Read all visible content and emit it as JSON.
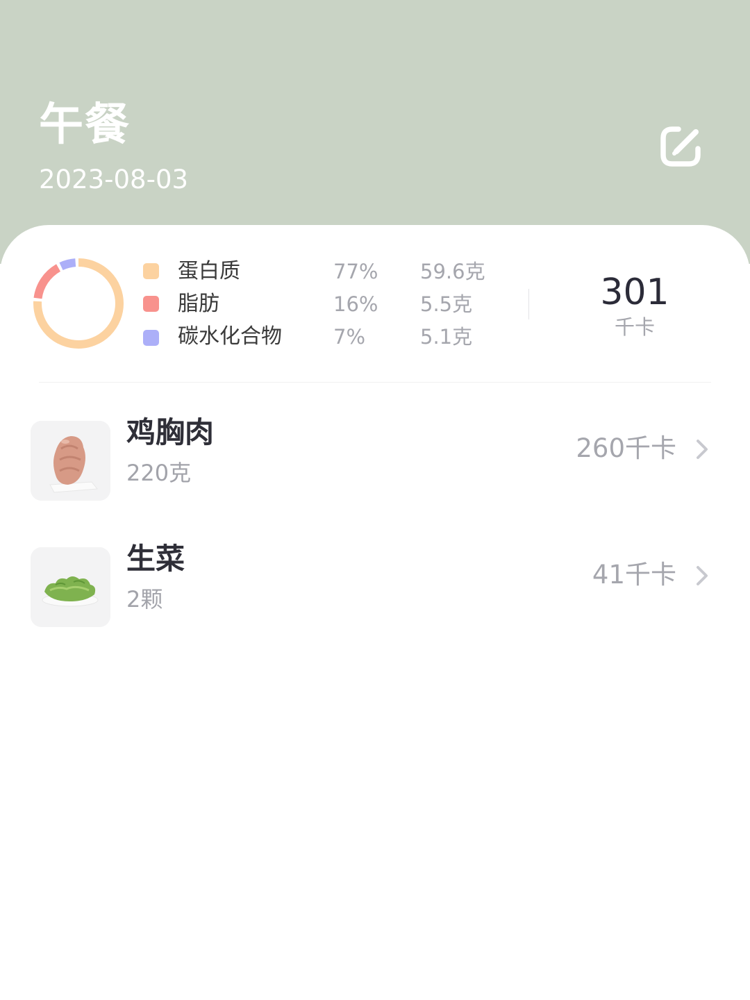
{
  "header": {
    "title": "午餐",
    "date": "2023-08-03",
    "edit_icon": "edit-icon",
    "background_color": "#c9d3c5"
  },
  "nutrition": {
    "macros": [
      {
        "name": "蛋白质",
        "percent": "77%",
        "amount": "59.6克",
        "color": "#fcd2a0",
        "fraction": 0.77
      },
      {
        "name": "脂肪",
        "percent": "16%",
        "amount": "5.5克",
        "color": "#f8928d",
        "fraction": 0.16
      },
      {
        "name": "碳水化合物",
        "percent": "7%",
        "amount": "5.1克",
        "color": "#acaff8",
        "fraction": 0.07
      }
    ],
    "total_value": "301",
    "total_unit": "千卡"
  },
  "foods": [
    {
      "name": "鸡胸肉",
      "amount": "220克",
      "calories": "260千卡",
      "image_icon": "chicken-breast-image",
      "chevron_icon": "chevron-right-icon"
    },
    {
      "name": "生菜",
      "amount": "2颗",
      "calories": "41千卡",
      "image_icon": "lettuce-image",
      "chevron_icon": "chevron-right-icon"
    }
  ]
}
